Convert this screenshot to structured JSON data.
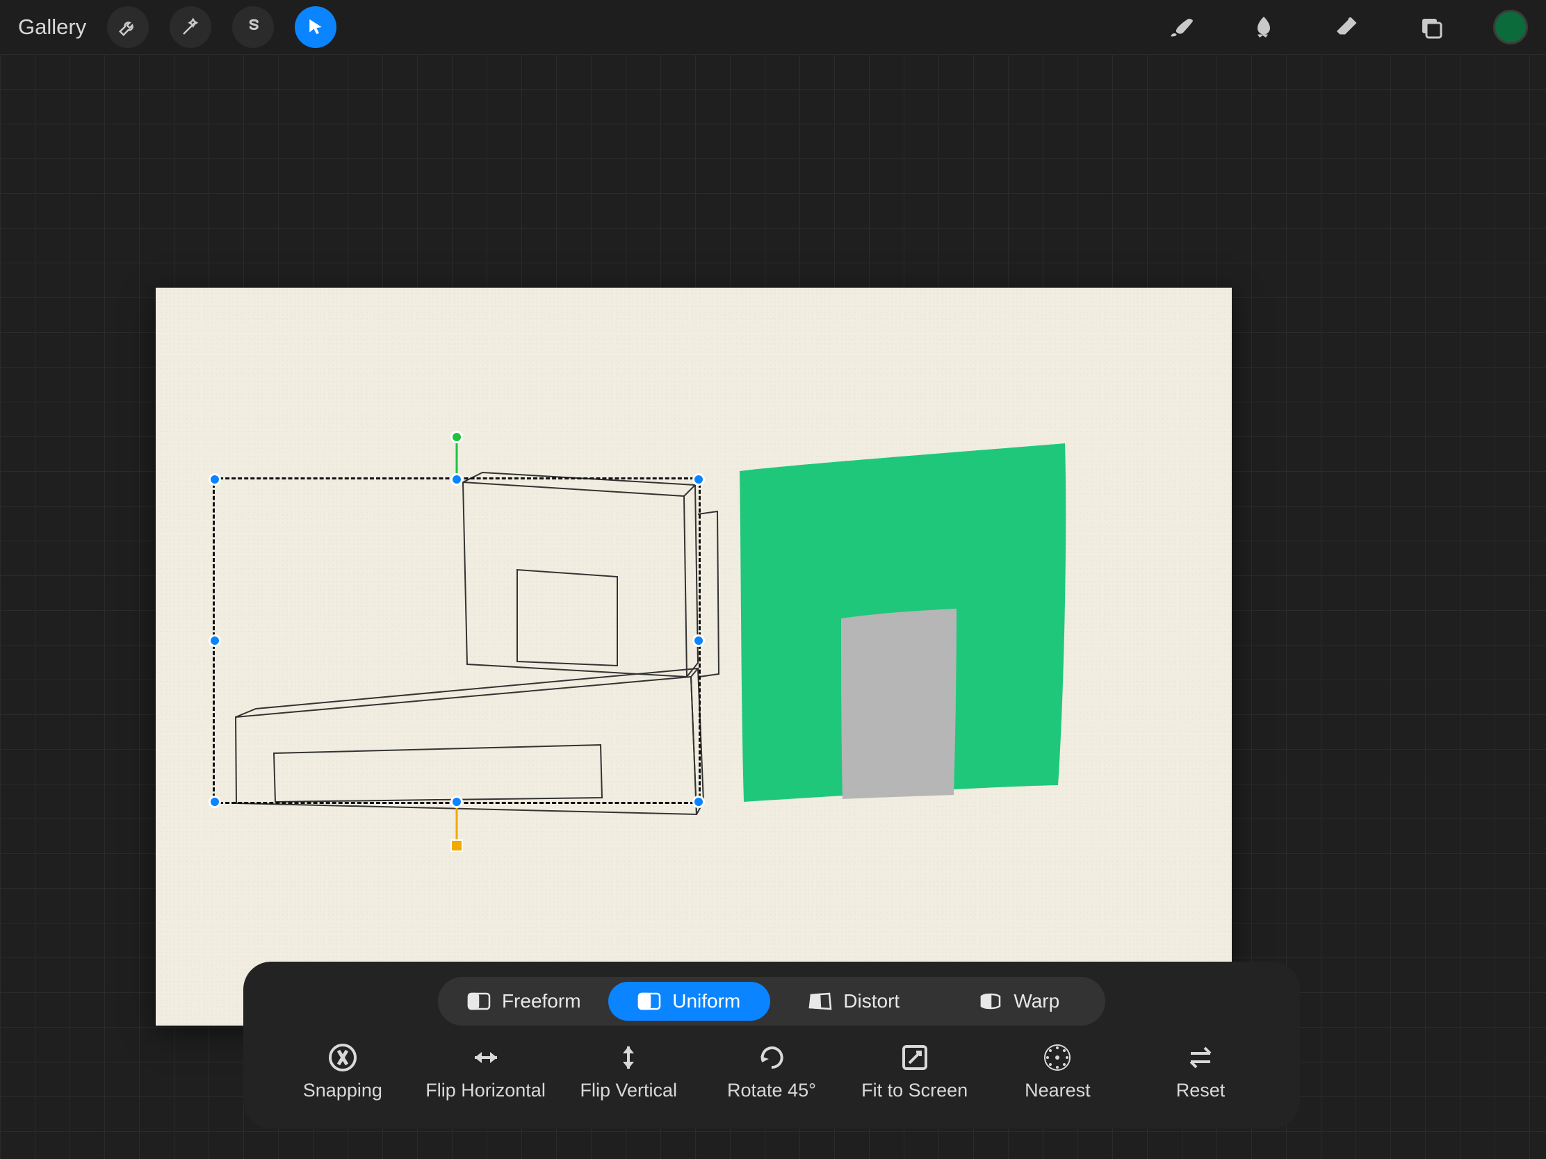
{
  "toolbar": {
    "gallery_label": "Gallery",
    "left_tools": [
      "wrench",
      "magic-wand",
      "selection-s",
      "cursor"
    ],
    "active_left_tool_index": 3,
    "right_tools": [
      "brush",
      "smudge",
      "eraser",
      "layers"
    ],
    "swatch_color": "#0b6b3a"
  },
  "transform_modes": {
    "items": [
      {
        "label": "Freeform"
      },
      {
        "label": "Uniform"
      },
      {
        "label": "Distort"
      },
      {
        "label": "Warp"
      }
    ],
    "active_index": 1
  },
  "transform_actions": {
    "items": [
      {
        "label": "Snapping"
      },
      {
        "label": "Flip Horizontal"
      },
      {
        "label": "Flip Vertical"
      },
      {
        "label": "Rotate 45°"
      },
      {
        "label": "Fit to Screen"
      },
      {
        "label": "Nearest"
      },
      {
        "label": "Reset"
      }
    ]
  },
  "canvas": {
    "paper_background": "#f1ede0",
    "green_shape_color": "#1fc77b",
    "gray_shape_color": "#b6b6b6",
    "line_color": "#333333"
  },
  "selection": {
    "handle_color": "#0a84ff",
    "rotate_handle_color": "#1ec43e",
    "scale_handle_color": "#f2a900"
  }
}
